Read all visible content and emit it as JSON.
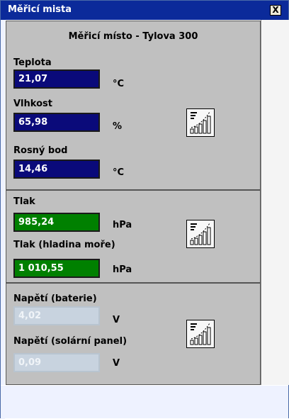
{
  "window": {
    "title": "Měřicí mista",
    "close_label": "X"
  },
  "section_temp": {
    "heading": "Měřicí místo - Tylova 300",
    "fields": [
      {
        "label": "Teplota",
        "value": "21,07",
        "unit": "°C"
      },
      {
        "label": "Vlhkost",
        "value": "65,98",
        "unit": "%"
      },
      {
        "label": "Rosný bod",
        "value": "14,46",
        "unit": "°C"
      }
    ]
  },
  "section_pressure": {
    "fields": [
      {
        "label": "Tlak",
        "value": "985,24",
        "unit": "hPa"
      },
      {
        "label": "Tlak (hladina moře)",
        "value": "1 010,55",
        "unit": "hPa"
      }
    ]
  },
  "section_voltage": {
    "fields": [
      {
        "label": "Napětí (baterie)",
        "value": "4,02",
        "unit": "V"
      },
      {
        "label": "Napětí (solární panel)",
        "value": "0,09",
        "unit": "V"
      }
    ]
  },
  "icons": {
    "chart": "bar-chart-icon",
    "close": "close-icon"
  },
  "colors": {
    "titlebar": "#0b2a9a",
    "temp_field": "#0a0a7a",
    "pressure_field": "#008000",
    "voltage_field_disabled": "#c8d3df",
    "panel": "#c0c0c0"
  }
}
